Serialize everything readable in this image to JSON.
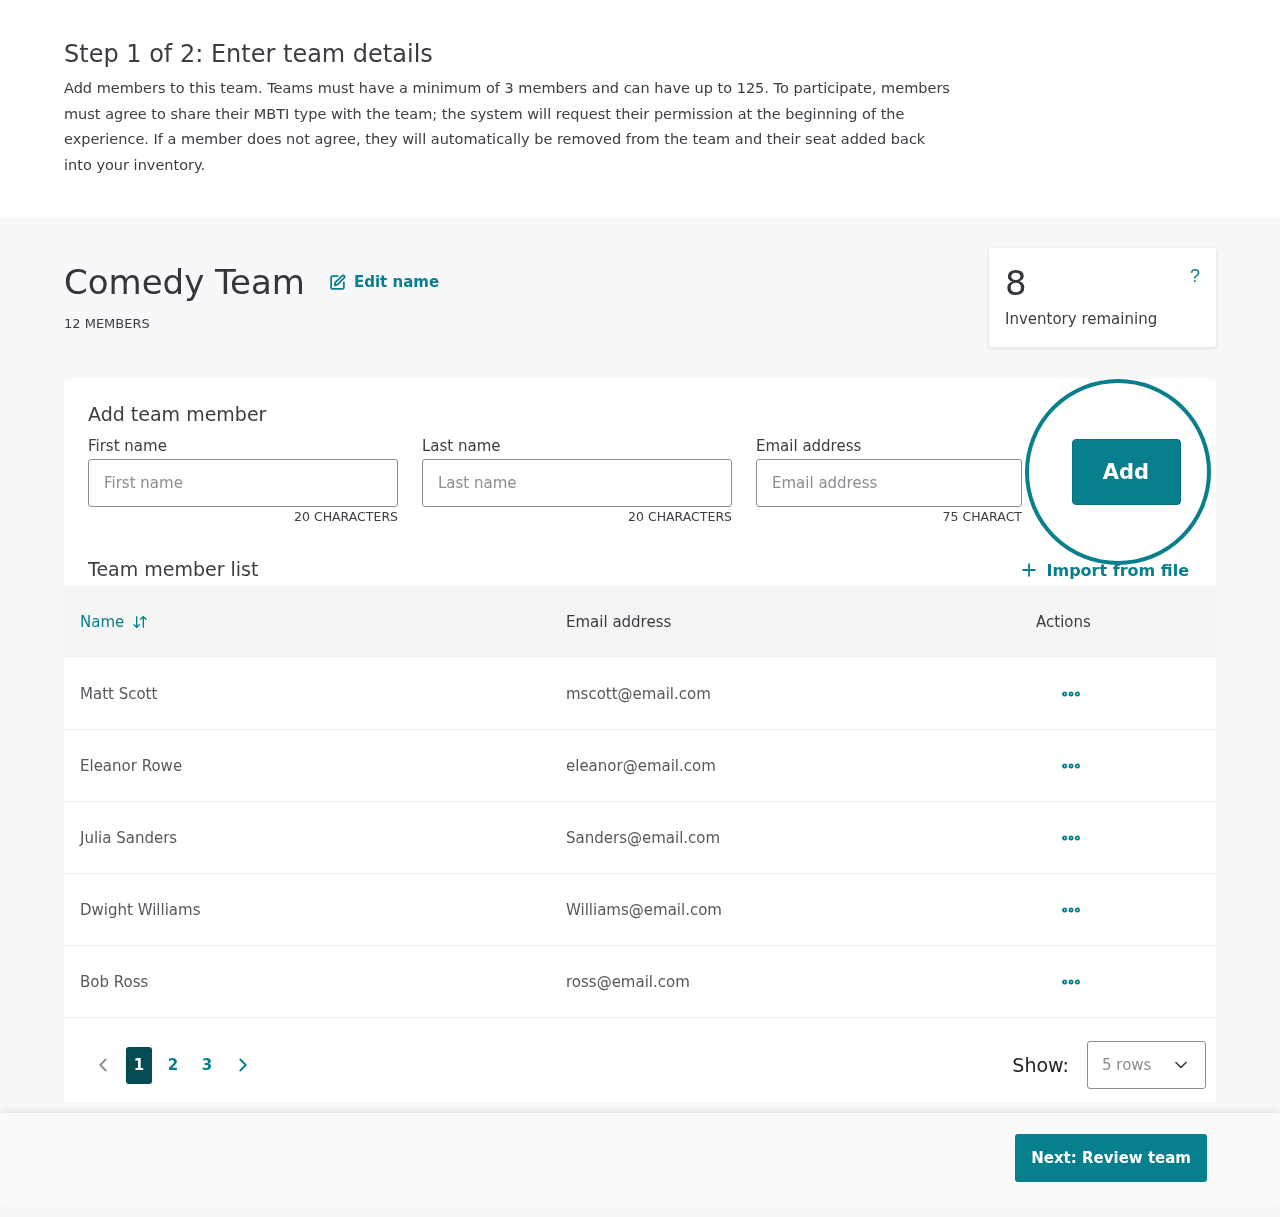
{
  "intro": {
    "title": "Step 1 of 2: Enter team details",
    "text": "Add members to this team. Teams must have a minimum of 3 members and can have up to 125. To participate, members must agree to share their MBTI type with the team; the system will request their permission at the beginning of the experience. If a member does not agree, they will automatically be removed from the team and their seat added back into your inventory."
  },
  "team": {
    "name": "Comedy Team",
    "edit_label": "Edit name",
    "members": "12 MEMBERS"
  },
  "inventory": {
    "count": "8",
    "label": "Inventory remaining",
    "help": "?"
  },
  "add_form": {
    "title": "Add team member",
    "fields": [
      {
        "label": "First name",
        "placeholder": "First name",
        "hint": "20 CHARACTERS"
      },
      {
        "label": "Last name",
        "placeholder": "Last name",
        "hint": "20 CHARACTERS"
      },
      {
        "label": "Email address",
        "placeholder": "Email address",
        "hint": "75 CHARACT"
      }
    ],
    "add_button": "Add"
  },
  "list": {
    "title": "Team member list",
    "import_label": "Import from file",
    "columns": [
      {
        "label": "Name",
        "sortable": true
      },
      {
        "label": "Email address",
        "sortable": false
      },
      {
        "label": "Actions",
        "sortable": false
      }
    ],
    "rows": [
      {
        "name": "Matt Scott",
        "email": "mscott@email.com"
      },
      {
        "name": "Eleanor Rowe",
        "email": "eleanor@email.com"
      },
      {
        "name": "Julia Sanders",
        "email": "Sanders@email.com"
      },
      {
        "name": "Dwight Williams",
        "email": "Williams@email.com"
      },
      {
        "name": "Bob Ross",
        "email": "ross@email.com"
      }
    ]
  },
  "pagination": {
    "prev_disabled": true,
    "next_disabled": false,
    "pages": [
      {
        "label": "1",
        "selected": true
      },
      {
        "label": "2",
        "selected": false
      },
      {
        "label": "3",
        "selected": false
      }
    ],
    "show_label": "Show:",
    "rows_value": "5 rows"
  },
  "footer": {
    "next_button": "Next: Review team"
  }
}
